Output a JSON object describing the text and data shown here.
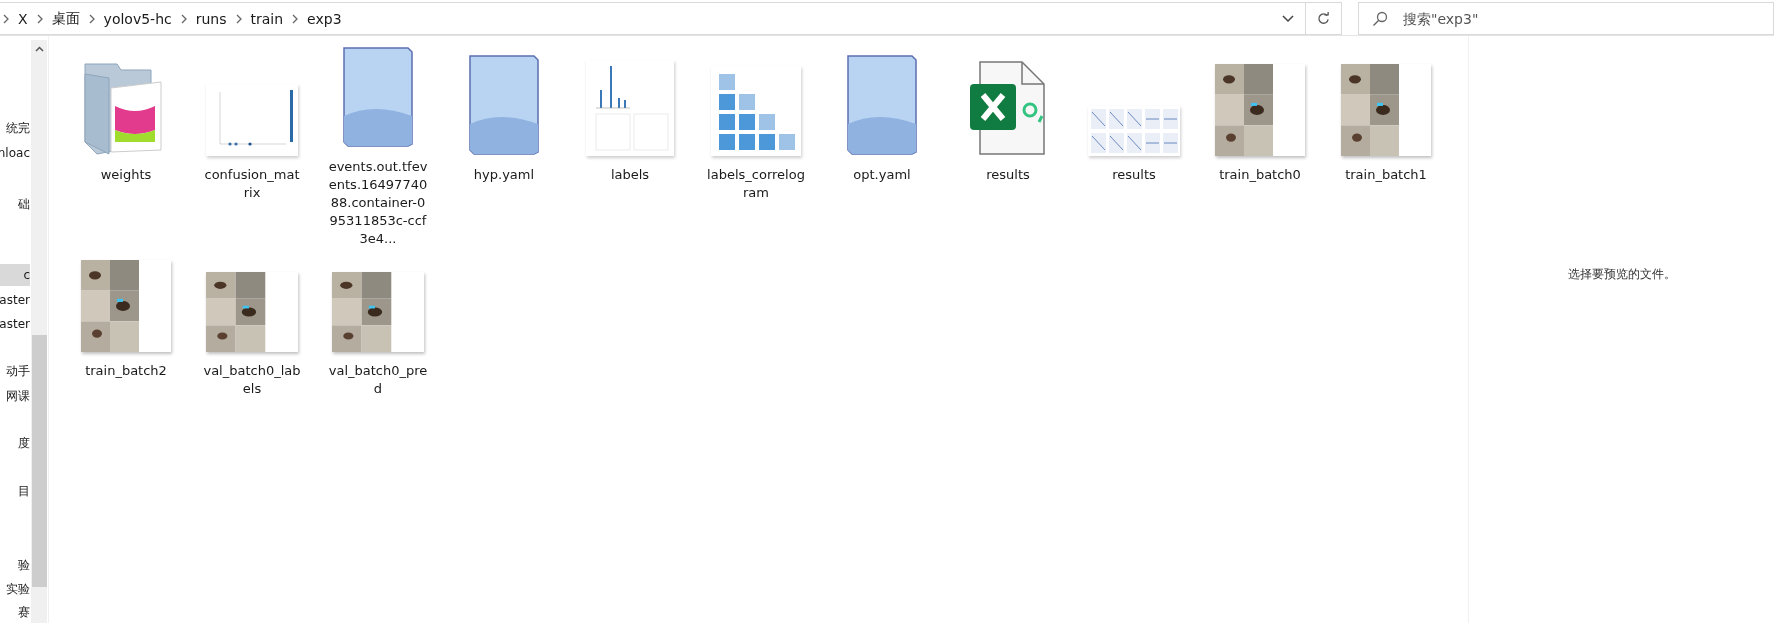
{
  "address_bar": {
    "breadcrumbs": [
      "X",
      "桌面",
      "yolov5-hc",
      "runs",
      "train",
      "exp3"
    ]
  },
  "search": {
    "placeholder": "搜索\"exp3\""
  },
  "sidebar": {
    "items": [
      {
        "label": "统完",
        "selected": false
      },
      {
        "label": "nloac",
        "selected": false
      },
      {
        "label": "础",
        "selected": false
      },
      {
        "label": "c",
        "selected": true
      },
      {
        "label": "aster",
        "selected": false
      },
      {
        "label": "aster",
        "selected": false
      },
      {
        "label": "动手",
        "selected": false
      },
      {
        "label": "网课",
        "selected": false
      },
      {
        "label": "度",
        "selected": false
      },
      {
        "label": "目",
        "selected": false
      },
      {
        "label": "验",
        "selected": false
      },
      {
        "label": "实验",
        "selected": false
      },
      {
        "label": "赛",
        "selected": false
      }
    ]
  },
  "files": [
    {
      "name": "weights",
      "kind": "folder"
    },
    {
      "name": "confusion_matrix",
      "kind": "matrix"
    },
    {
      "name": "events.out.tfevents.1649774088.container-095311853c-ccf3e4...",
      "kind": "blank"
    },
    {
      "name": "hyp.yaml",
      "kind": "blank"
    },
    {
      "name": "labels",
      "kind": "labels"
    },
    {
      "name": "labels_correlogram",
      "kind": "correlogram"
    },
    {
      "name": "opt.yaml",
      "kind": "blank"
    },
    {
      "name": "results",
      "kind": "spreadsheet"
    },
    {
      "name": "results",
      "kind": "plots"
    },
    {
      "name": "train_batch0",
      "kind": "photos"
    },
    {
      "name": "train_batch1",
      "kind": "photos"
    },
    {
      "name": "train_batch2",
      "kind": "photos"
    },
    {
      "name": "val_batch0_labels",
      "kind": "photos_small"
    },
    {
      "name": "val_batch0_pred",
      "kind": "photos_small"
    }
  ],
  "preview_pane": {
    "message": "选择要预览的文件。"
  }
}
